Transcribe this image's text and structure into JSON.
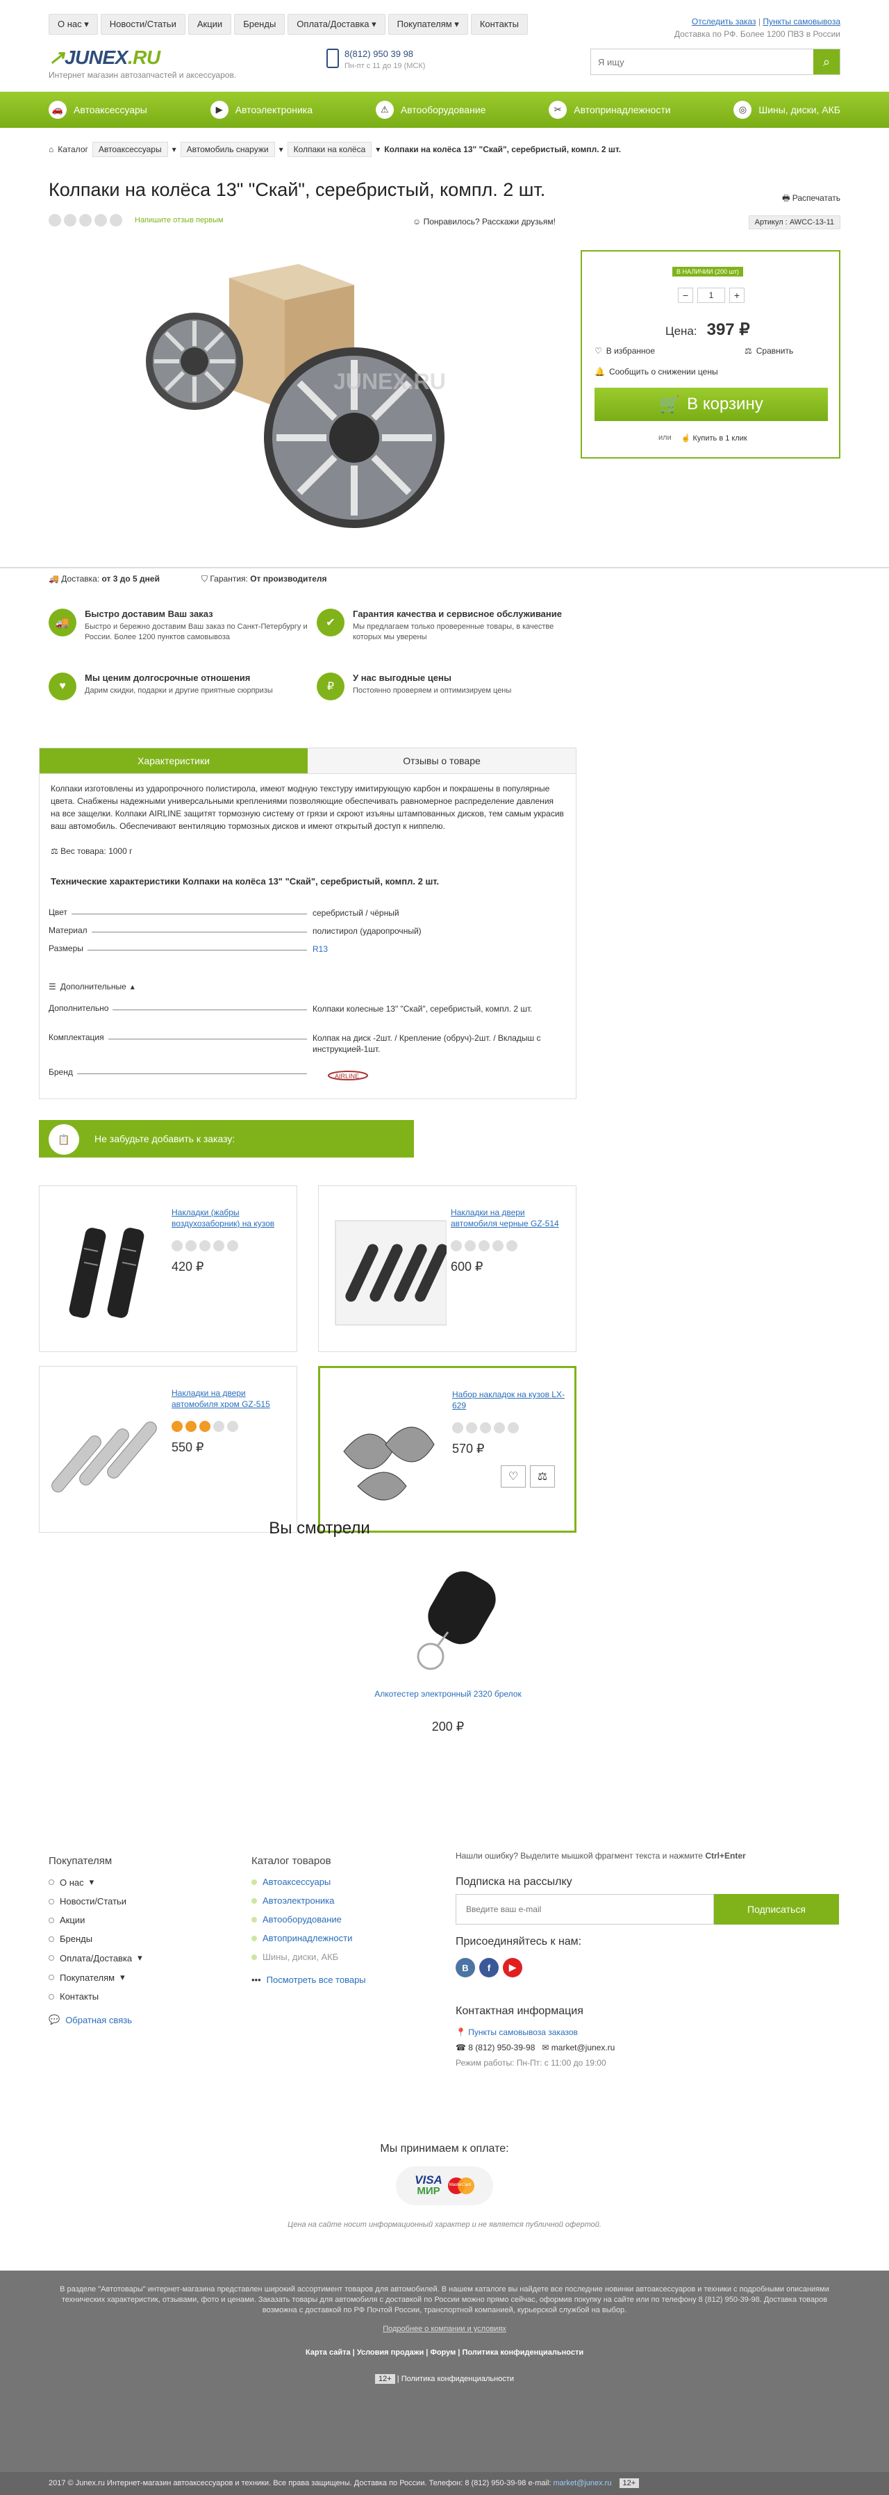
{
  "top_nav": [
    {
      "label": "О нас",
      "dd": true
    },
    {
      "label": "Новости/Статьи",
      "dd": false
    },
    {
      "label": "Акции",
      "dd": false
    },
    {
      "label": "Бренды",
      "dd": false
    },
    {
      "label": "Оплата/Доставка",
      "dd": true
    },
    {
      "label": "Покупателям",
      "dd": true
    },
    {
      "label": "Контакты",
      "dd": false
    }
  ],
  "top_links": {
    "track": "Отследить заказ",
    "pickup": "Пункты самовывоза",
    "delivery_note": "Доставка по РФ. Более 1200 ПВЗ в России"
  },
  "logo": {
    "brand": "JUNEX",
    "tld": ".RU",
    "tagline": "Интернет магазин автозапчастей и аксессуаров."
  },
  "phone": {
    "number": "8(812) 950 39 98",
    "hours": "Пн-пт с 11 до 19 (МСК)"
  },
  "search": {
    "placeholder": "Я ищу"
  },
  "main_menu": [
    {
      "label": "Автоаксессуары",
      "icon": "car-icon"
    },
    {
      "label": "Автоэлектроника",
      "icon": "play-icon"
    },
    {
      "label": "Автооборудование",
      "icon": "warning-icon"
    },
    {
      "label": "Автопринадлежности",
      "icon": "tools-icon"
    },
    {
      "label": "Шины, диски, АКБ",
      "icon": "wheel-icon"
    }
  ],
  "breadcrumb": {
    "catalog": "Каталог",
    "items": [
      "Автоаксессуары",
      "Автомобиль снаружи",
      "Колпаки на колёса"
    ],
    "current": "Колпаки на колёса 13\" \"Скай\", серебристый, компл. 2 шт."
  },
  "product": {
    "title": "Колпаки на колёса 13\" \"Скай\", серебристый, компл. 2 шт.",
    "print": "Распечатать",
    "review_link": "Напишите отзыв первым",
    "share": "Понравилось? Расскажи друзьям!",
    "article": "Артикул : AWCC-13-11",
    "watermark": "JUNEX.RU"
  },
  "buy_box": {
    "availability": "В НАЛИЧИИ (200 шт)",
    "qty": "1",
    "price_label": "Цена:",
    "price": "397 ₽",
    "favorites": "В избранное",
    "compare": "Сравнить",
    "notify": "Сообщить о снижении цены",
    "cart": "В корзину",
    "or": "или",
    "one_click": "Купить в 1 клик"
  },
  "delivery": {
    "label": "Доставка:",
    "value": "от 3 до 5 дней",
    "warranty_label": "Гарантия:",
    "warranty_value": "От производителя"
  },
  "features": [
    {
      "title": "Быстро доставим Ваш заказ",
      "text": "Быстро и бережно доставим Ваш заказ по Санкт-Петербургу и России. Более 1200 пунктов самовывоза",
      "icon": "truck-icon"
    },
    {
      "title": "Гарантия качества и сервисное обслуживание",
      "text": "Мы предлагаем только проверенные товары, в качестве которых мы уверены",
      "icon": "shield-icon"
    },
    {
      "title": "Мы ценим долгосрочные отношения",
      "text": "Дарим скидки, подарки и другие приятные сюрпризы",
      "icon": "handshake-icon"
    },
    {
      "title": "У нас выгодные цены",
      "text": "Постоянно проверяем и оптимизируем цены",
      "icon": "ruble-icon"
    }
  ],
  "tabs": [
    "Характеристики",
    "Отзывы о товаре"
  ],
  "description": "Колпаки изготовлены из ударопрочного полистирола, имеют модную текстуру имитирующую карбон и покрашены в популярные цвета. Снабжены надежными универсальными креплениями позволяющие обеспечивать равномерное распределение давления на все защелки. Колпаки AIRLINE защитят тормозную систему от грязи и скроют изъяны штампованных дисков, тем самым украсив ваш автомобиль. Обеспечивают вентиляцию тормозных дисков и имеют открытый доступ к ниппелю.",
  "weight": "Вес товара: 1000 г",
  "spec_title": "Технические характеристики Колпаки на колёса 13\" \"Скай\", серебристый, компл. 2 шт.",
  "specs": [
    {
      "k": "Цвет",
      "v": "серебристый / чёрный",
      "link": false
    },
    {
      "k": "Материал",
      "v": "полистирол (ударопрочный)",
      "link": false
    },
    {
      "k": "Размеры",
      "v": "R13",
      "link": true
    }
  ],
  "extra_toggle": "Дополнительные",
  "extra_specs": [
    {
      "k": "Дополнительно",
      "v": "Колпаки колесные 13\" \"Скай\", серебристый, компл. 2 шт."
    },
    {
      "k": "Комплектация",
      "v": "Колпак на диск -2шт. / Крепление (обруч)-2шт. / Вкладыш с инструкцией-1шт."
    },
    {
      "k": "Бренд",
      "v": ""
    }
  ],
  "banner": "Не забудьте добавить к заказу:",
  "related": [
    {
      "name": "Накладки (жабры воздухозаборник) на кузов",
      "price": "420 ₽",
      "stars": 0
    },
    {
      "name": "Накладки на двери автомобиля черные GZ-514",
      "price": "600 ₽",
      "stars": 0
    },
    {
      "name": "Накладки на двери автомобиля хром GZ-515",
      "price": "550 ₽",
      "stars": 3
    },
    {
      "name": "Набор накладок на кузов LX-629",
      "price": "570 ₽",
      "stars": 0
    }
  ],
  "seen": {
    "title": "Вы смотрели",
    "name": "Алкотестер электронный 2320 брелок",
    "price": "200 ₽"
  },
  "footer": {
    "buyers_title": "Покупателям",
    "buyers": [
      "О нас",
      "Новости/Статьи",
      "Акции",
      "Бренды",
      "Оплата/Доставка",
      "Покупателям",
      "Контакты"
    ],
    "feedback": "Обратная связь",
    "catalog_title": "Каталог товаров",
    "catalog": [
      "Автоаксессуары",
      "Автоэлектроника",
      "Автооборудование",
      "Автопринадлежности",
      "Шины, диски, АКБ"
    ],
    "all_goods": "Посмотреть все товары",
    "error_note": "Нашли ошибку? Выделите мышкой фрагмент текста и нажмите",
    "error_keys": "Ctrl+Enter",
    "subscribe_title": "Подписка на рассылку",
    "email_placeholder": "Введите ваш e-mail",
    "subscribe_btn": "Подписаться",
    "join": "Присоединяйтесь к нам:",
    "contact_title": "Контактная информация",
    "pickup": "Пункты самовывоза заказов",
    "phone": "8 (812) 950-39-98",
    "email": "market@junex.ru",
    "hours": "Режим работы: Пн-Пт: с 11:00 до 19:00",
    "pay_title": "Мы принимаем к оплате:",
    "visa": "VISA",
    "mir": "МИР",
    "mc": "MasterCard",
    "offer": "Цена на сайте носит информационный характер и не является публичной офертой."
  },
  "bottom": {
    "text": "В разделе \"Автотовары\" интернет-магазина представлен широкий ассортимент товаров для автомобилей. В нашем каталоге вы найдете все последние новинки автоаксессуаров и техники с подробными описаниями технических характеристик, отзывами, фото и ценами. Заказать товары для автомобиля с доставкой по России можно прямо сейчас, оформив покупку на сайте или по телефону 8 (812) 950-39-98. Доставка товаров возможна с доставкой по РФ Почтой России, транспортной компанией, курьерской службой на выбор.",
    "details": "Подробнее о компании и условиях",
    "links": [
      "Карта сайта",
      "Условия продажи",
      "Форум",
      "Политика конфиденциальности"
    ],
    "age": "12+",
    "policy": "Политика конфиденциальности",
    "copyright": "2017 © Junex.ru Интернет-магазин автоаксессуаров и техники. Все права защищены. Доставка по России. Телефон: 8 (812) 950-39-98 e-mail:",
    "copyright_mail": "market@junex.ru"
  },
  "colors": {
    "accent": "#80b31a",
    "brand": "#2d4d7c",
    "link": "#2a6ebb"
  }
}
